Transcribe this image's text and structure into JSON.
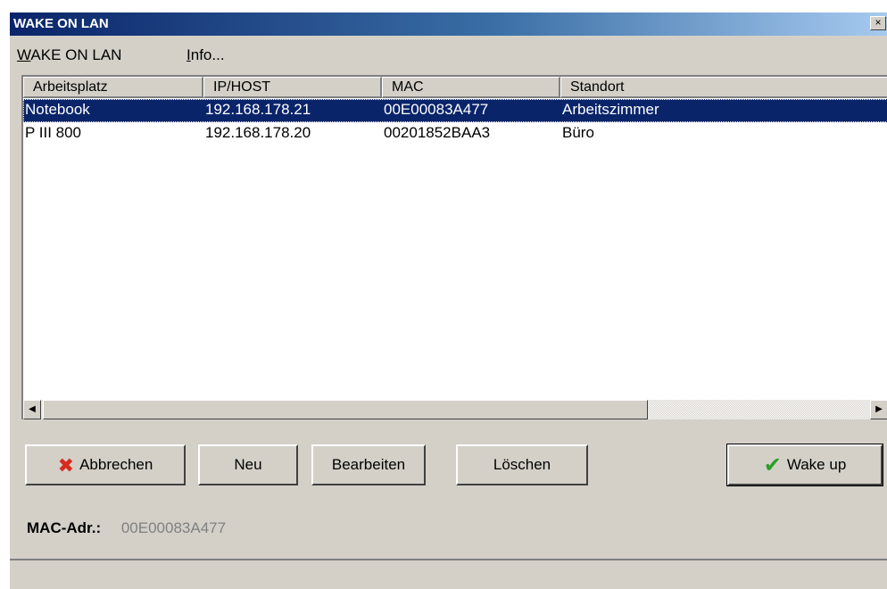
{
  "window": {
    "title": "WAKE ON LAN",
    "close_glyph": "×"
  },
  "menu": [
    {
      "label_ul": "W",
      "label_rest": "AKE ON LAN"
    },
    {
      "label_ul": "I",
      "label_rest": "nfo..."
    }
  ],
  "table": {
    "columns": [
      "Arbeitsplatz",
      "IP/HOST",
      "MAC",
      "Standort"
    ],
    "rows": [
      {
        "arbeitsplatz": "Notebook",
        "host": "192.168.178.21",
        "mac": "00E00083A477",
        "standort": "Arbeitszimmer",
        "selected": true
      },
      {
        "arbeitsplatz": "P III 800",
        "host": "192.168.178.20",
        "mac": "00201852BAA3",
        "standort": "Büro",
        "selected": false
      }
    ]
  },
  "scrollbar": {
    "left_arrow": "◀",
    "right_arrow": "▶"
  },
  "buttons": {
    "cancel": "Abbrechen",
    "new": "Neu",
    "edit": "Bearbeiten",
    "delete": "Löschen",
    "wake": "Wake up"
  },
  "icons": {
    "cancel": "x-icon",
    "wake": "checkmark-icon"
  },
  "mac": {
    "label": "MAC-Adr.:",
    "value": "00E00083A477"
  },
  "colors": {
    "selection": "#0a246a",
    "cancel_icon": "#d62b1e",
    "wake_icon": "#2a9d2a"
  }
}
